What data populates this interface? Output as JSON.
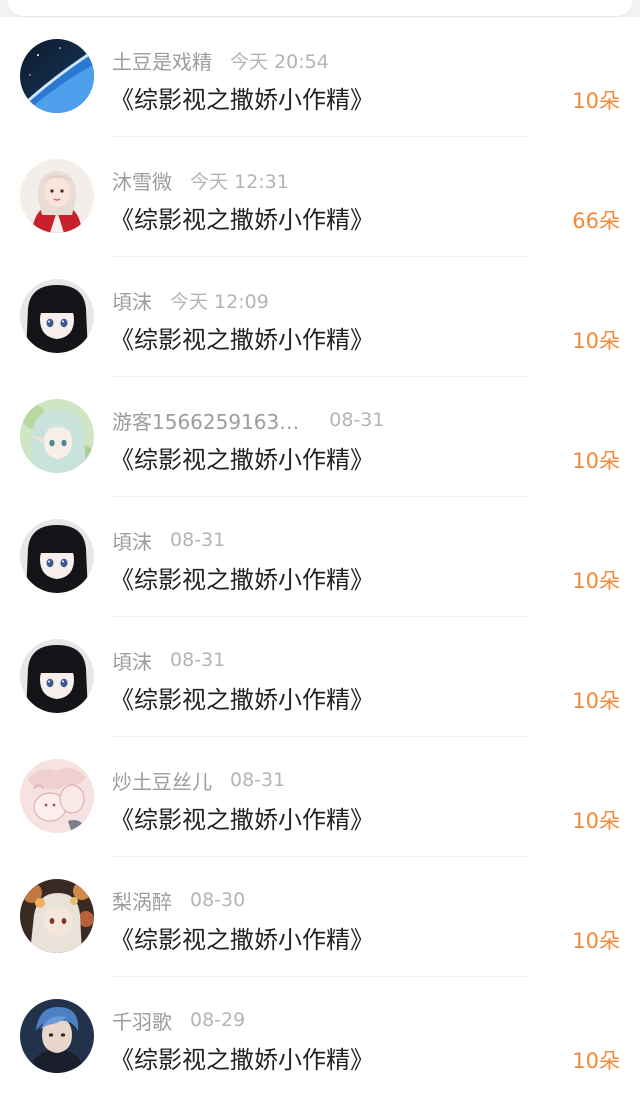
{
  "records": [
    {
      "avatar": "planet-earth-avatar",
      "name": "土豆是戏精",
      "time": "今天 20:54",
      "book": "《综影视之撒娇小作精》",
      "gift": "10朵"
    },
    {
      "avatar": "girl-red-dress-avatar",
      "name": "沐雪微",
      "time": "今天 12:31",
      "book": "《综影视之撒娇小作精》",
      "gift": "66朵"
    },
    {
      "avatar": "anime-black-hair-avatar",
      "name": "頃沫",
      "time": "今天 12:09",
      "book": "《综影视之撒娇小作精》",
      "gift": "10朵"
    },
    {
      "avatar": "anime-elf-avatar",
      "name": "游客1566259163…",
      "time": "08-31",
      "book": "《综影视之撒娇小作精》",
      "gift": "10朵"
    },
    {
      "avatar": "anime-black-hair-avatar",
      "name": "頃沫",
      "time": "08-31",
      "book": "《综影视之撒娇小作精》",
      "gift": "10朵"
    },
    {
      "avatar": "anime-black-hair-avatar",
      "name": "頃沫",
      "time": "08-31",
      "book": "《综影视之撒娇小作精》",
      "gift": "10朵"
    },
    {
      "avatar": "pink-sketch-avatar",
      "name": "炒土豆丝儿",
      "time": "08-31",
      "book": "《综影视之撒娇小作精》",
      "gift": "10朵"
    },
    {
      "avatar": "flower-girl-avatar",
      "name": "梨涡醉",
      "time": "08-30",
      "book": "《综影视之撒娇小作精》",
      "gift": "10朵"
    },
    {
      "avatar": "blue-hair-man-avatar",
      "name": "千羽歌",
      "time": "08-29",
      "book": "《综影视之撒娇小作精》",
      "gift": "10朵"
    }
  ],
  "colors": {
    "gift_accent": "#f08a3a",
    "name_gray": "#9c9c9c",
    "time_gray": "#b4b4b4",
    "title_dark": "#222222"
  }
}
